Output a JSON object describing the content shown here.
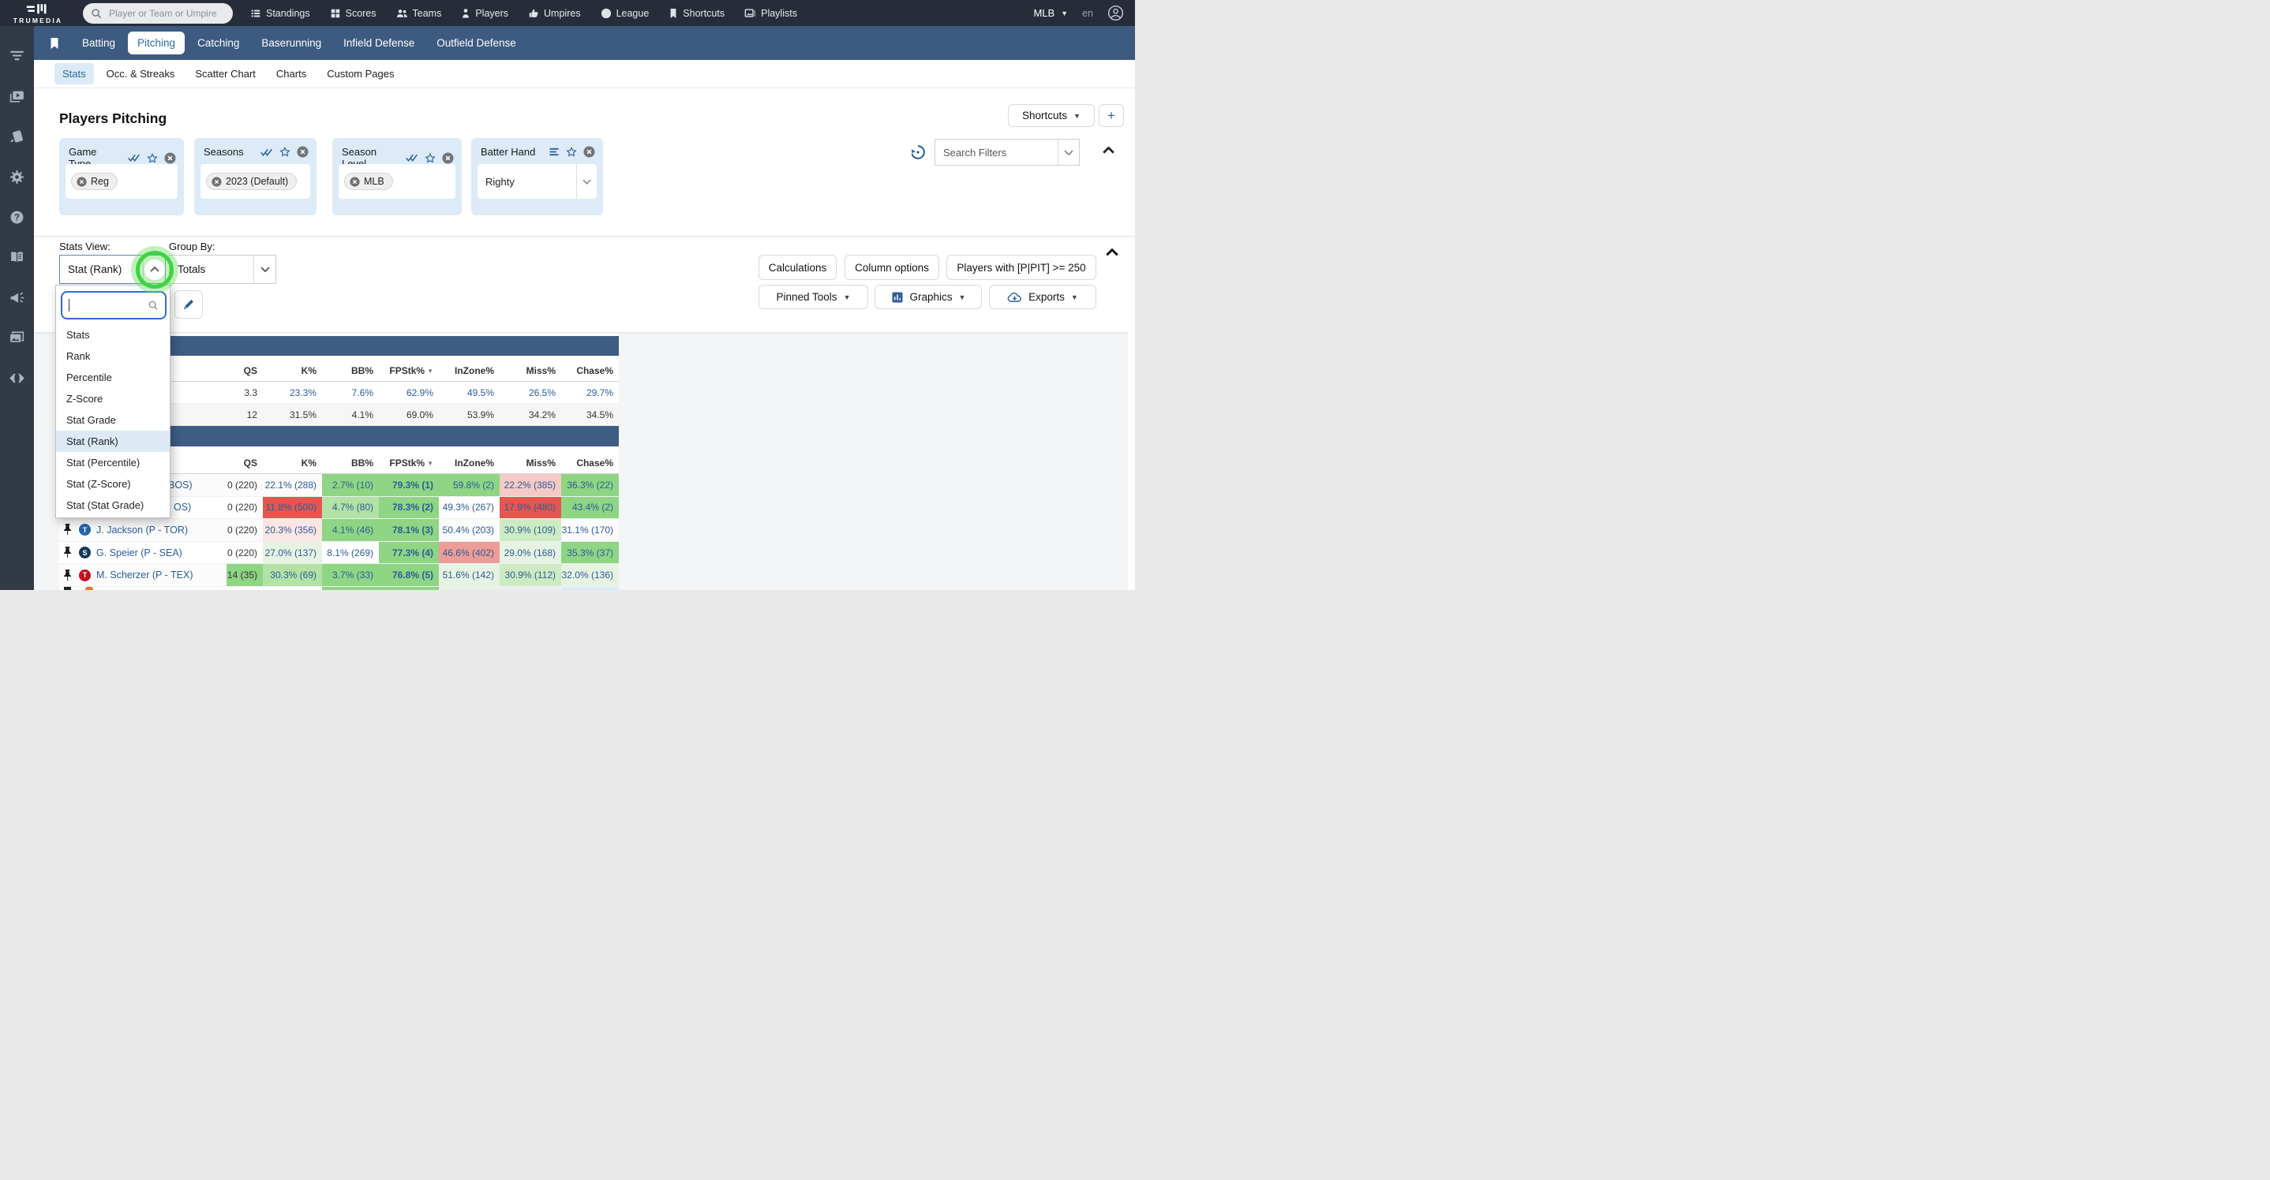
{
  "topbar": {
    "logo_text": "TRUMEDIA",
    "search_placeholder": "Player or Team or Umpire",
    "nav": [
      {
        "label": "Standings"
      },
      {
        "label": "Scores"
      },
      {
        "label": "Teams"
      },
      {
        "label": "Players"
      },
      {
        "label": "Umpires"
      },
      {
        "label": "League"
      },
      {
        "label": "Shortcuts"
      },
      {
        "label": "Playlists"
      }
    ],
    "league_selector": "MLB",
    "language": "en"
  },
  "blue_nav": {
    "tabs": [
      {
        "label": "Batting",
        "cls": ""
      },
      {
        "label": "Pitching",
        "cls": "active"
      },
      {
        "label": "Catching",
        "cls": ""
      },
      {
        "label": "Baserunning",
        "cls": ""
      },
      {
        "label": "Infield Defense",
        "cls": ""
      },
      {
        "label": "Outfield Defense",
        "cls": ""
      }
    ]
  },
  "subnav": {
    "items": [
      {
        "label": "Stats",
        "cls": "active"
      },
      {
        "label": "Occ. & Streaks",
        "cls": ""
      },
      {
        "label": "Scatter Chart",
        "cls": ""
      },
      {
        "label": "Charts",
        "cls": ""
      },
      {
        "label": "Custom Pages",
        "cls": ""
      }
    ]
  },
  "page": {
    "title": "Players Pitching",
    "shortcuts_button": "Shortcuts",
    "add_button": "+"
  },
  "filter_cards": [
    {
      "title": "Game Type",
      "chips": [
        "Reg"
      ]
    },
    {
      "title": "Seasons",
      "chips": [
        "2023 (Default)"
      ]
    },
    {
      "title": "Season Level",
      "chips": [
        "MLB"
      ]
    },
    {
      "title": "Batter Hand",
      "select_value": "Righty"
    }
  ],
  "filter_tools": {
    "search_filters_placeholder": "Search Filters"
  },
  "controls": {
    "stats_view_label": "Stats View:",
    "stats_view_value": "Stat (Rank)",
    "group_by_label": "Group By:",
    "group_by_value": "Totals",
    "dropdown_search_value": "",
    "buttons_row1": [
      {
        "label": "Calculations"
      },
      {
        "label": "Column options"
      },
      {
        "label": "Players with [P|PIT] >= 250"
      }
    ],
    "buttons_row2": [
      {
        "label": "Pinned Tools"
      },
      {
        "label": "Graphics"
      },
      {
        "label": "Exports"
      }
    ]
  },
  "stats_view_dropdown": {
    "items": [
      {
        "label": "Stats",
        "cls": ""
      },
      {
        "label": "Rank",
        "cls": ""
      },
      {
        "label": "Percentile",
        "cls": ""
      },
      {
        "label": "Z-Score",
        "cls": ""
      },
      {
        "label": "Stat Grade",
        "cls": ""
      },
      {
        "label": "Stat (Rank)",
        "cls": "sel"
      },
      {
        "label": "Stat (Percentile)",
        "cls": ""
      },
      {
        "label": "Stat (Z-Score)",
        "cls": ""
      },
      {
        "label": "Stat (Stat Grade)",
        "cls": ""
      }
    ]
  },
  "table": {
    "columns": [
      {
        "label": "QS",
        "cls": ""
      },
      {
        "label": "K%",
        "cls": ""
      },
      {
        "label": "BB%",
        "cls": ""
      },
      {
        "label": "FPStk%",
        "cls": "sorted"
      },
      {
        "label": "InZone%",
        "cls": ""
      },
      {
        "label": "Miss%",
        "cls": ""
      },
      {
        "label": "Chase%",
        "cls": ""
      }
    ],
    "sorted_by": "FPStk% descending",
    "summary_rows": [
      {
        "cells": [
          {
            "v": "3.3",
            "t": "dk",
            "bg": ""
          },
          {
            "v": "23.3%",
            "t": "lk",
            "bg": ""
          },
          {
            "v": "7.6%",
            "t": "lk",
            "bg": ""
          },
          {
            "v": "62.9%",
            "t": "lk",
            "bg": ""
          },
          {
            "v": "49.5%",
            "t": "lk",
            "bg": ""
          },
          {
            "v": "26.5%",
            "t": "lk",
            "bg": ""
          },
          {
            "v": "29.7%",
            "t": "lk",
            "bg": ""
          }
        ]
      },
      {
        "cells": [
          {
            "v": "12",
            "t": "dk",
            "bg": ""
          },
          {
            "v": "31.5%",
            "t": "dk",
            "bg": ""
          },
          {
            "v": "4.1%",
            "t": "dk",
            "bg": ""
          },
          {
            "v": "69.0%",
            "t": "dk",
            "bg": ""
          },
          {
            "v": "53.9%",
            "t": "dk",
            "bg": ""
          },
          {
            "v": "34.2%",
            "t": "dk",
            "bg": ""
          },
          {
            "v": "34.5%",
            "t": "dk",
            "bg": ""
          }
        ]
      }
    ],
    "player_rows": [
      {
        "name": "BOS)",
        "name_class": "frag",
        "logo": "",
        "logo_class": "none",
        "cells": [
          {
            "v": "0 (220)",
            "t": "dk",
            "bg": ""
          },
          {
            "v": "22.1% (288)",
            "t": "lk",
            "bg": ""
          },
          {
            "v": "2.7% (10)",
            "t": "lk",
            "bg": "g1"
          },
          {
            "v": "79.3% (1)",
            "t": "lk b",
            "bg": "g1"
          },
          {
            "v": "59.8% (2)",
            "t": "lk",
            "bg": "g1"
          },
          {
            "v": "22.2% (385)",
            "t": "lk",
            "bg": "r3"
          },
          {
            "v": "36.3% (22)",
            "t": "lk",
            "bg": "g1"
          }
        ]
      },
      {
        "name": "OS)",
        "name_class": "frag2",
        "logo": "",
        "logo_class": "none",
        "cells": [
          {
            "v": "0 (220)",
            "t": "dk",
            "bg": ""
          },
          {
            "v": "11.8% (500)",
            "t": "lk",
            "bg": "r1"
          },
          {
            "v": "4.7% (80)",
            "t": "lk",
            "bg": "g2"
          },
          {
            "v": "78.3% (2)",
            "t": "lk b",
            "bg": "g1"
          },
          {
            "v": "49.3% (267)",
            "t": "lk",
            "bg": ""
          },
          {
            "v": "17.9% (480)",
            "t": "lk",
            "bg": "r1"
          },
          {
            "v": "43.4% (2)",
            "t": "lk",
            "bg": "g1"
          }
        ]
      },
      {
        "name": "J. Jackson (P - TOR)",
        "name_class": "",
        "logo": "T",
        "logo_class": "tor",
        "cells": [
          {
            "v": "0 (220)",
            "t": "dk",
            "bg": ""
          },
          {
            "v": "20.3% (356)",
            "t": "lk",
            "bg": "r4"
          },
          {
            "v": "4.1% (46)",
            "t": "lk",
            "bg": "g1"
          },
          {
            "v": "78.1% (3)",
            "t": "lk b",
            "bg": "g1"
          },
          {
            "v": "50.4% (203)",
            "t": "lk",
            "bg": ""
          },
          {
            "v": "30.9% (109)",
            "t": "lk",
            "bg": "g3"
          },
          {
            "v": "31.1% (170)",
            "t": "lk",
            "bg": ""
          }
        ]
      },
      {
        "name": "G. Speier (P - SEA)",
        "name_class": "",
        "logo": "S",
        "logo_class": "sea",
        "cells": [
          {
            "v": "0 (220)",
            "t": "dk",
            "bg": ""
          },
          {
            "v": "27.0% (137)",
            "t": "lk",
            "bg": "g4"
          },
          {
            "v": "8.1% (269)",
            "t": "lk",
            "bg": ""
          },
          {
            "v": "77.3% (4)",
            "t": "lk b",
            "bg": "g1"
          },
          {
            "v": "46.6% (402)",
            "t": "lk",
            "bg": "r2"
          },
          {
            "v": "29.0% (168)",
            "t": "lk",
            "bg": "g4"
          },
          {
            "v": "35.3% (37)",
            "t": "lk",
            "bg": "g1"
          }
        ]
      },
      {
        "name": "M. Scherzer (P - TEX)",
        "name_class": "",
        "logo": "T",
        "logo_class": "tex",
        "cells": [
          {
            "v": "14 (35)",
            "t": "dk",
            "bg": "g1"
          },
          {
            "v": "30.3% (69)",
            "t": "lk",
            "bg": "g2"
          },
          {
            "v": "3.7% (33)",
            "t": "lk",
            "bg": "g1"
          },
          {
            "v": "76.8% (5)",
            "t": "lk b",
            "bg": "g1"
          },
          {
            "v": "51.6% (142)",
            "t": "lk",
            "bg": "g4"
          },
          {
            "v": "30.9% (112)",
            "t": "lk",
            "bg": "g3"
          },
          {
            "v": "32.0% (136)",
            "t": "lk",
            "bg": "g4"
          }
        ]
      }
    ],
    "partial_row_bg": [
      "",
      "",
      "",
      "",
      "g1",
      "g1",
      "g4",
      "p1",
      "p2"
    ]
  },
  "colors": {
    "topbar": "#262d39",
    "sidebar": "#323a47",
    "nav_blue": "#3d5a80",
    "header_band": "#3e5c84",
    "link_blue": "#2b5c99",
    "accent_blue": "#2d5f9b",
    "green_strong": "#8ed584",
    "green_medium": "#b2e2a4",
    "green_light": "#cdebc2",
    "green_faint": "#e7f3e2",
    "red_strong": "#e4574e",
    "red_salmon": "#ee9d96",
    "red_pink": "#f5c9c6",
    "red_faint": "#fbe6e4",
    "highlight_ring": "#3fd245"
  }
}
